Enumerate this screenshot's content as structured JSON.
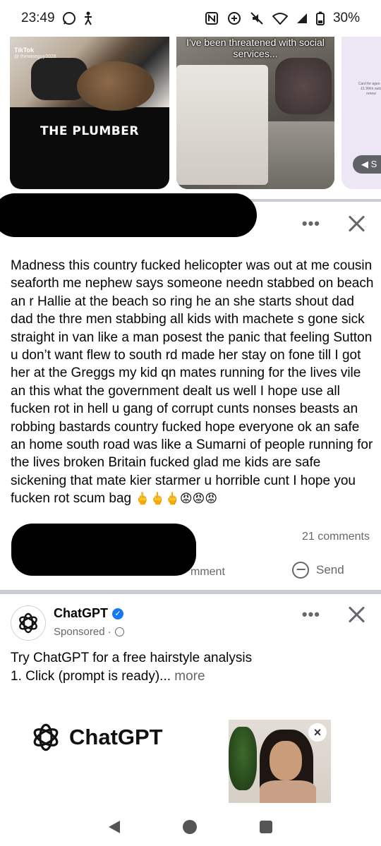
{
  "status_bar": {
    "time": "23:49",
    "battery": "30%"
  },
  "reels": [
    {
      "brand": "TikTok",
      "handle": "@ thewiseguy2026",
      "caption": "THE PLUMBER"
    },
    {
      "caption": "I've been threatened with social services..."
    },
    {
      "small_text": "Card for ages or £1.99/m auto renew",
      "pill": "S"
    }
  ],
  "post": {
    "body": "Madness this country fucked helicopter was out at me cousin seaforth me nephew says someone needn stabbed on beach an r Hallie at the beach so ring he an she starts shout dad dad the thre men stabbing all kids with machete s gone sick straight in van like a man posest the panic that feeling Sutton u don’t want flew to south rd made her stay on fone till I got her at the Greggs my kid qn mates running for the lives vile an this what the government dealt us well I hope use all fucken rot in hell u gang of corrupt cunts nonses beasts an robbing bastards country fucked hope everyone ok an safe an home south road was like a Sumarni of people running for the lives broken Britain fucked glad me kids are safe sickening that mate kier starmer u horrible cunt I hope you fucken rot scum bag",
    "emojis": "🖕🖕🖕😡😡😡",
    "comments": "21 comments",
    "comment_label": "mment",
    "send_label": "Send"
  },
  "ad": {
    "name": "ChatGPT",
    "sponsored": "Sponsored ·",
    "text": "Try ChatGPT for a free hairstyle analysis\n1. Click (prompt is ready)...",
    "more": "more",
    "brand": "ChatGPT"
  },
  "icons": {
    "whatsapp": "whatsapp-icon",
    "accessibility": "accessibility-icon",
    "nfc": "nfc-icon",
    "mute": "mute-icon",
    "wifi": "wifi-icon",
    "signal": "signal-icon",
    "battery": "battery-icon"
  }
}
